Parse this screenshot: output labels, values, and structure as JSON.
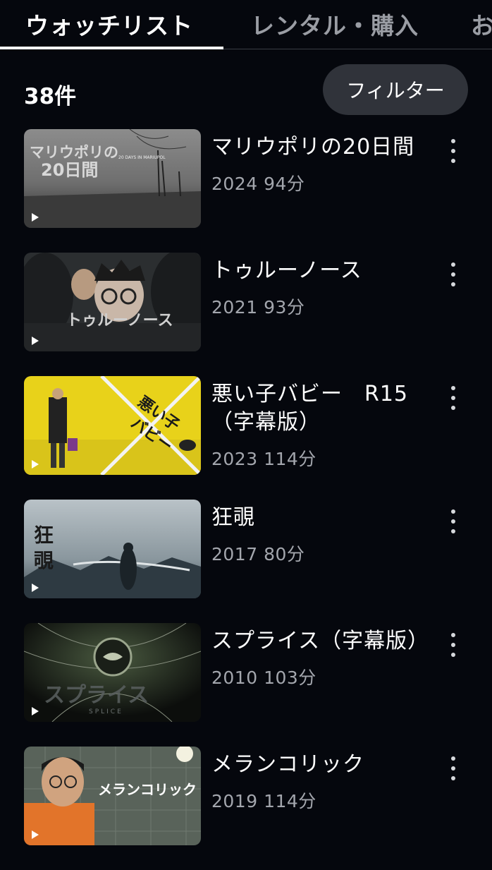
{
  "tabs": [
    {
      "label": "ウォッチリスト",
      "active": true
    },
    {
      "label": "レンタル・購入",
      "active": false
    },
    {
      "label": "お",
      "active": false
    }
  ],
  "count_label": "38件",
  "filter_label": "フィルター",
  "items": [
    {
      "title": "マリウポリの20日間",
      "year": "2024",
      "duration": "94分",
      "thumb_caption": "マリウポリの\n20日間",
      "thumb_sub": "20 DAYS IN MARIUPOL"
    },
    {
      "title": "トゥルーノース",
      "year": "2021",
      "duration": "93分",
      "thumb_caption": "トゥルーノース"
    },
    {
      "title": "悪い子バビー　R15（字幕版）",
      "year": "2023",
      "duration": "114分",
      "thumb_caption": "悪い子バビー"
    },
    {
      "title": "狂覗",
      "year": "2017",
      "duration": "80分",
      "thumb_caption": "狂覗"
    },
    {
      "title": "スプライス（字幕版）",
      "year": "2010",
      "duration": "103分",
      "thumb_caption": "スプライス",
      "thumb_sub": "SPLICE"
    },
    {
      "title": "メランコリック",
      "year": "2019",
      "duration": "114分",
      "thumb_caption": "メランコリック"
    }
  ],
  "icons": {
    "play": "play-icon",
    "more": "more-vertical-icon"
  },
  "colors": {
    "background": "#05070d",
    "filter_button": "#30333a",
    "secondary_text": "#a3a6ad"
  }
}
